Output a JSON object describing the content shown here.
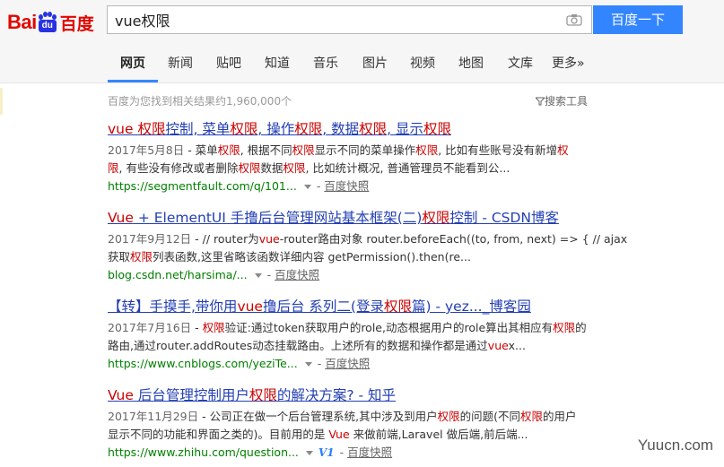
{
  "logo": {
    "bai": "Bai",
    "du": "du",
    "cn": "百度"
  },
  "search": {
    "value": "vue权限",
    "button_label": "百度一下"
  },
  "nav": {
    "items": [
      {
        "label": "网页"
      },
      {
        "label": "新闻"
      },
      {
        "label": "贴吧"
      },
      {
        "label": "知道"
      },
      {
        "label": "音乐"
      },
      {
        "label": "图片"
      },
      {
        "label": "视频"
      },
      {
        "label": "地图"
      },
      {
        "label": "文库"
      },
      {
        "label": "更多»"
      }
    ],
    "active": "网页"
  },
  "result_count": "百度为您找到相关结果约1,960,000个",
  "search_tools": "搜索工具",
  "results": [
    {
      "title_html": "<em>vue 权限</em>控制, 菜单<em>权限</em>, 操作<em>权限</em>, 数据<em>权限</em>, 显示<em>权限</em>",
      "date": "2017年5月8日",
      "abstract_line1_html": "- 菜单<em>权限</em>, 根据不同<em>权限</em>显示不同的菜单操作<em>权限</em>, 比如有些账号没有新增<em>权</em>",
      "abstract_line2_html": "<em>限</em>, 有些没有修改或者删除<em>权限</em>数据<em>权限</em>, 比如统计概况, 普通管理员不能看到公...",
      "url": "https://segmentfault.com/q/101...",
      "cache": "百度快照"
    },
    {
      "title_html": "<em>Vue</em> + ElementUI 手撸后台管理网站基本框架(二)<em>权限</em>控制 - CSDN博客",
      "date": "2017年9月12日",
      "abstract_line1_html": "- // router为<em>vue</em>-router路由对象 router.beforeEach((to, from, next) => { // ajax",
      "abstract_line2_html": "获取<em>权限</em>列表函数,这里省略该函数详细内容 getPermission().then(re...",
      "url": "blog.csdn.net/harsima/...",
      "cache": "百度快照"
    },
    {
      "title_html": "【转】手摸手,带你用<em>vue</em>撸后台 系列二(登录<em>权限</em>篇) - yez..._博客园",
      "date": "2017年7月16日",
      "abstract_line1_html": "- <em>权限</em>验证:通过token获取用户的role,动态根据用户的role算出其相应有<em>权限</em>的",
      "abstract_line2_html": "路由,通过router.addRoutes动态挂载路由。上述所有的数据和操作都是通过<em>vue</em>x...",
      "url": "https://www.cnblogs.com/yeziTe...",
      "cache": "百度快照"
    },
    {
      "title_html": "<em>Vue</em> 后台管理控制用户<em>权限</em>的解决方案? - 知乎",
      "date": "2017年11月29日",
      "abstract_line1_html": "- 公司正在做一个后台管理系统,其中涉及到用户<em>权限</em>的问题(不同<em>权限</em>的用户",
      "abstract_line2_html": "显示不同的功能和界面之类的)。目前用的是 <em>Vue</em> 来做前端,Laravel 做后端,前后端...",
      "url": "https://www.zhihu.com/question...",
      "v_badge": "V1",
      "cache": "百度快照"
    }
  ],
  "watermark": "Yuucn.com"
}
